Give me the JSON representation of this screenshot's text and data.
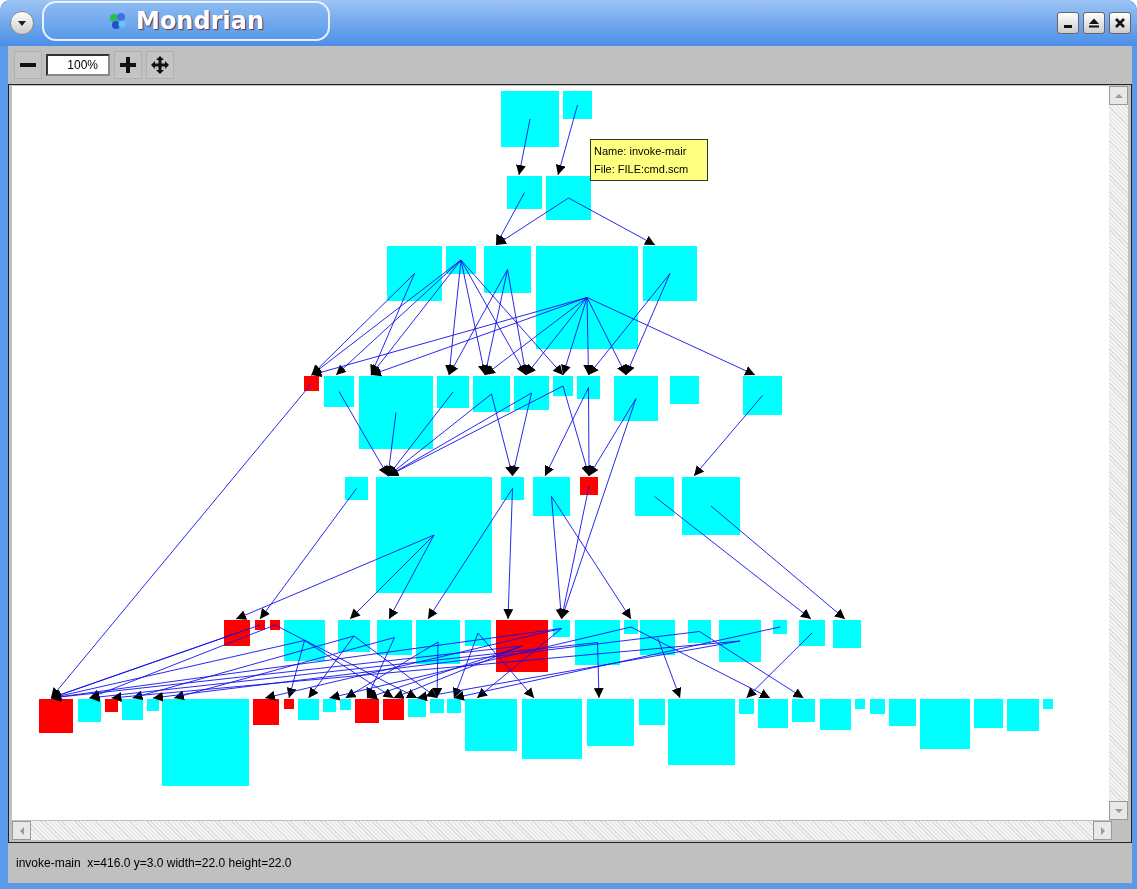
{
  "window": {
    "title": "Mondrian"
  },
  "toolbar": {
    "zoom_value": "100%"
  },
  "tooltip": {
    "lines": [
      "Name: invoke-mair",
      "File: FILE:cmd.scm"
    ]
  },
  "status_bar": {
    "text": "invoke-main  x=416.0 y=3.0 width=22.0 height=22.0"
  }
}
